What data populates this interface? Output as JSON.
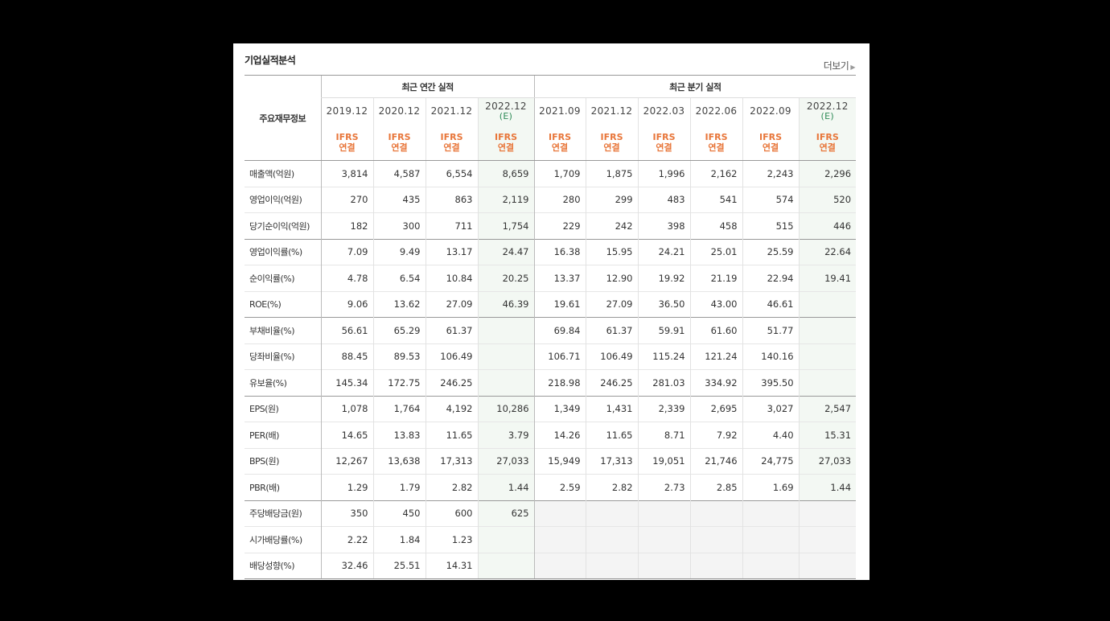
{
  "panel": {
    "title": "기업실적분석",
    "more_label": "더보기",
    "table": {
      "row_header_label": "주요재무정보",
      "group_annual": "최근 연간 실적",
      "group_quarter": "최근 분기 실적",
      "columns": [
        {
          "date": "2019.12",
          "est": "",
          "ifrs1": "IFRS",
          "ifrs2": "연결"
        },
        {
          "date": "2020.12",
          "est": "",
          "ifrs1": "IFRS",
          "ifrs2": "연결"
        },
        {
          "date": "2021.12",
          "est": "",
          "ifrs1": "IFRS",
          "ifrs2": "연결"
        },
        {
          "date": "2022.12",
          "est": "(E)",
          "ifrs1": "IFRS",
          "ifrs2": "연결"
        },
        {
          "date": "2021.09",
          "est": "",
          "ifrs1": "IFRS",
          "ifrs2": "연결"
        },
        {
          "date": "2021.12",
          "est": "",
          "ifrs1": "IFRS",
          "ifrs2": "연결"
        },
        {
          "date": "2022.03",
          "est": "",
          "ifrs1": "IFRS",
          "ifrs2": "연결"
        },
        {
          "date": "2022.06",
          "est": "",
          "ifrs1": "IFRS",
          "ifrs2": "연결"
        },
        {
          "date": "2022.09",
          "est": "",
          "ifrs1": "IFRS",
          "ifrs2": "연결"
        },
        {
          "date": "2022.12",
          "est": "(E)",
          "ifrs1": "IFRS",
          "ifrs2": "연결"
        }
      ],
      "rows": [
        {
          "label": "매출액(억원)",
          "values": [
            "3,814",
            "4,587",
            "6,554",
            "8,659",
            "1,709",
            "1,875",
            "1,996",
            "2,162",
            "2,243",
            "2,296"
          ]
        },
        {
          "label": "영업이익(억원)",
          "values": [
            "270",
            "435",
            "863",
            "2,119",
            "280",
            "299",
            "483",
            "541",
            "574",
            "520"
          ]
        },
        {
          "label": "당기순이익(억원)",
          "values": [
            "182",
            "300",
            "711",
            "1,754",
            "229",
            "242",
            "398",
            "458",
            "515",
            "446"
          ]
        },
        {
          "label": "영업이익률(%)",
          "values": [
            "7.09",
            "9.49",
            "13.17",
            "24.47",
            "16.38",
            "15.95",
            "24.21",
            "25.01",
            "25.59",
            "22.64"
          ]
        },
        {
          "label": "순이익률(%)",
          "values": [
            "4.78",
            "6.54",
            "10.84",
            "20.25",
            "13.37",
            "12.90",
            "19.92",
            "21.19",
            "22.94",
            "19.41"
          ]
        },
        {
          "label": "ROE(%)",
          "values": [
            "9.06",
            "13.62",
            "27.09",
            "46.39",
            "19.61",
            "27.09",
            "36.50",
            "43.00",
            "46.61",
            ""
          ]
        },
        {
          "label": "부채비율(%)",
          "values": [
            "56.61",
            "65.29",
            "61.37",
            "",
            "69.84",
            "61.37",
            "59.91",
            "61.60",
            "51.77",
            ""
          ]
        },
        {
          "label": "당좌비율(%)",
          "values": [
            "88.45",
            "89.53",
            "106.49",
            "",
            "106.71",
            "106.49",
            "115.24",
            "121.24",
            "140.16",
            ""
          ]
        },
        {
          "label": "유보율(%)",
          "values": [
            "145.34",
            "172.75",
            "246.25",
            "",
            "218.98",
            "246.25",
            "281.03",
            "334.92",
            "395.50",
            ""
          ]
        },
        {
          "label": "EPS(원)",
          "values": [
            "1,078",
            "1,764",
            "4,192",
            "10,286",
            "1,349",
            "1,431",
            "2,339",
            "2,695",
            "3,027",
            "2,547"
          ]
        },
        {
          "label": "PER(배)",
          "values": [
            "14.65",
            "13.83",
            "11.65",
            "3.79",
            "14.26",
            "11.65",
            "8.71",
            "7.92",
            "4.40",
            "15.31"
          ]
        },
        {
          "label": "BPS(원)",
          "values": [
            "12,267",
            "13,638",
            "17,313",
            "27,033",
            "15,949",
            "17,313",
            "19,051",
            "21,746",
            "24,775",
            "27,033"
          ]
        },
        {
          "label": "PBR(배)",
          "values": [
            "1.29",
            "1.79",
            "2.82",
            "1.44",
            "2.59",
            "2.82",
            "2.73",
            "2.85",
            "1.69",
            "1.44"
          ]
        },
        {
          "label": "주당배당금(원)",
          "values": [
            "350",
            "450",
            "600",
            "625",
            "",
            "",
            "",
            "",
            "",
            ""
          ]
        },
        {
          "label": "시가배당률(%)",
          "values": [
            "2.22",
            "1.84",
            "1.23",
            "",
            "",
            "",
            "",
            "",
            "",
            ""
          ]
        },
        {
          "label": "배당성향(%)",
          "values": [
            "32.46",
            "25.51",
            "14.31",
            "",
            "",
            "",
            "",
            "",
            "",
            ""
          ]
        }
      ],
      "section_breaks": [
        3,
        6,
        9,
        13
      ],
      "empty_quarter_rows": [
        13,
        14,
        15
      ]
    }
  }
}
